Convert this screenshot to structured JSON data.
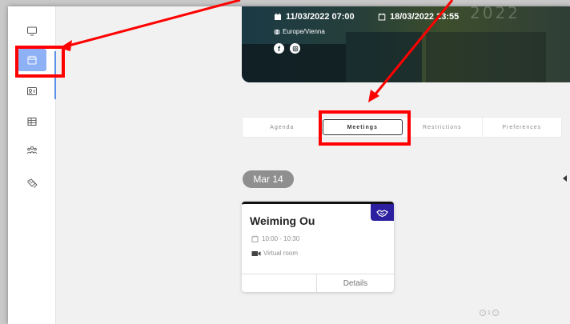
{
  "sidebar": {
    "items": [
      {
        "icon": "monitor-icon"
      },
      {
        "icon": "calendar-icon",
        "active": true
      },
      {
        "icon": "contact-card-icon"
      },
      {
        "icon": "table-icon"
      },
      {
        "icon": "people-icon"
      },
      {
        "icon": "tags-icon"
      }
    ],
    "active_color": "#8eb1f5"
  },
  "banner": {
    "start": "11/03/2022 07:00",
    "end": "18/03/2022 23:55",
    "timezone": "Europe/Vienna",
    "year_watermark": "2022",
    "social": [
      "facebook-icon",
      "instagram-icon"
    ]
  },
  "tabs": [
    {
      "label": "Agenda",
      "active": false
    },
    {
      "label": "Meetings",
      "active": true
    },
    {
      "label": "Restrictions",
      "active": false
    },
    {
      "label": "Preferences",
      "active": false
    }
  ],
  "date_pill": "Mar 14",
  "meeting": {
    "name": "Weiming Ou",
    "time": "10:00 - 10:30",
    "location": "Virtual room",
    "details_label": "Details",
    "badge_icon": "handshake-icon",
    "badge_color": "#2c1fa0"
  },
  "pagination": {
    "page": "1"
  },
  "annotation_color": "#ff0000"
}
